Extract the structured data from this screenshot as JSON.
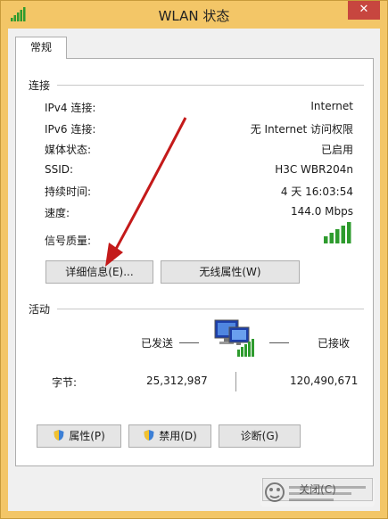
{
  "window": {
    "title": "WLAN 状态",
    "close_glyph": "✕"
  },
  "tabs": [
    {
      "label": "常规"
    }
  ],
  "connection": {
    "heading": "连接",
    "rows": [
      {
        "label": "IPv4 连接:",
        "value": "Internet"
      },
      {
        "label": "IPv6 连接:",
        "value": "无 Internet 访问权限"
      },
      {
        "label": "媒体状态:",
        "value": "已启用"
      },
      {
        "label": "SSID:",
        "value": "H3C WBR204n"
      },
      {
        "label": "持续时间:",
        "value": "4 天 16:03:54"
      },
      {
        "label": "速度:",
        "value": "144.0 Mbps"
      }
    ],
    "signal_label": "信号质量:",
    "signal_level": "5/5",
    "details_button": "详细信息(E)...",
    "wireless_props_button": "无线属性(W)"
  },
  "activity": {
    "heading": "活动",
    "sent_label": "已发送",
    "received_label": "已接收",
    "bytes_label": "字节:",
    "bytes_sent": "25,312,987",
    "bytes_received": "120,490,671"
  },
  "buttons": {
    "properties": "属性(P)",
    "disable": "禁用(D)",
    "diagnose": "诊断(G)",
    "close": "关闭(C)"
  },
  "colors": {
    "title_bar": "#f3c667",
    "signal_green": "#2e9b2e",
    "arrow_red": "#c41a1a"
  },
  "icons": [
    "signal-bars-icon",
    "close-icon",
    "shield-icon",
    "network-computers-icon"
  ]
}
